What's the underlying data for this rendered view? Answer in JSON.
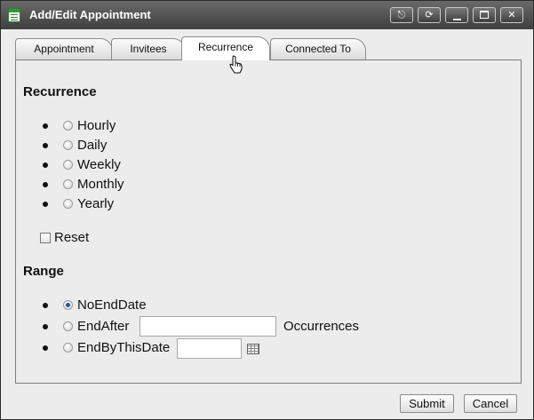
{
  "window": {
    "title": "Add/Edit Appointment",
    "controls": [
      "pin-icon",
      "refresh-icon",
      "minimize-icon",
      "maximize-icon",
      "close-icon"
    ]
  },
  "tabs": [
    {
      "label": "Appointment",
      "active": false
    },
    {
      "label": "Invitees",
      "active": false
    },
    {
      "label": "Recurrence",
      "active": true
    },
    {
      "label": "Connected To",
      "active": false
    }
  ],
  "recurrence": {
    "heading": "Recurrence",
    "options": [
      {
        "label": "Hourly",
        "checked": false
      },
      {
        "label": "Daily",
        "checked": false
      },
      {
        "label": "Weekly",
        "checked": false
      },
      {
        "label": "Monthly",
        "checked": false
      },
      {
        "label": "Yearly",
        "checked": false
      }
    ],
    "reset_label": "Reset",
    "reset_checked": false
  },
  "range": {
    "heading": "Range",
    "no_end_label": "NoEndDate",
    "no_end_checked": true,
    "end_after_label": "EndAfter",
    "end_after_value": "",
    "occurrences_label": "Occurrences",
    "end_by_label": "EndByThisDate",
    "end_by_value": ""
  },
  "footer": {
    "submit_label": "Submit",
    "cancel_label": "Cancel"
  },
  "colors": {
    "titlebar": "#4a4a4a",
    "radio_selected": "#2a4f86"
  }
}
